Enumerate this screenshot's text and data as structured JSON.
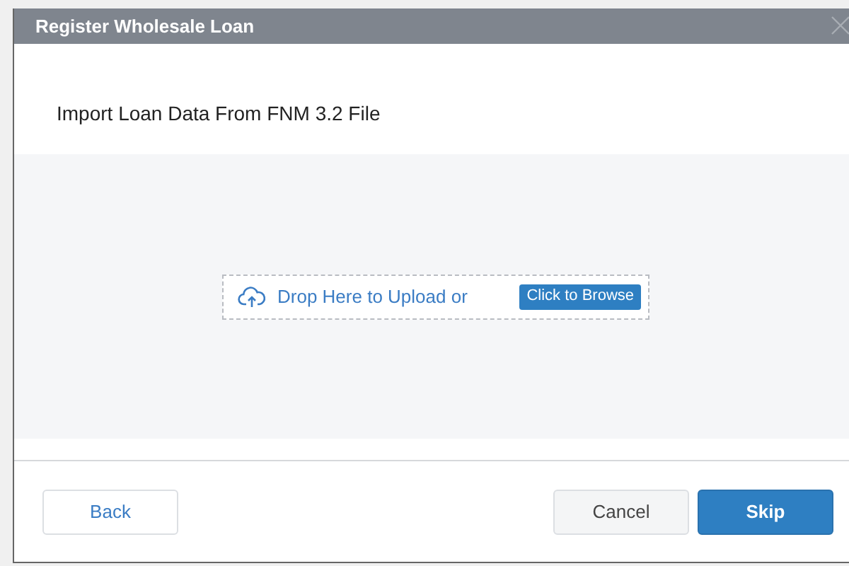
{
  "dialog": {
    "title": "Register Wholesale Loan"
  },
  "heading": "Import Loan Data From FNM 3.2 File",
  "dropzone": {
    "prompt": "Drop Here to Upload or",
    "browse_button": "Click to Browse"
  },
  "buttons": [
    {
      "label": "Back",
      "kind": "secondary"
    },
    {
      "label": "Cancel",
      "kind": "neutral"
    },
    {
      "label": "Skip",
      "kind": "primary"
    }
  ]
}
